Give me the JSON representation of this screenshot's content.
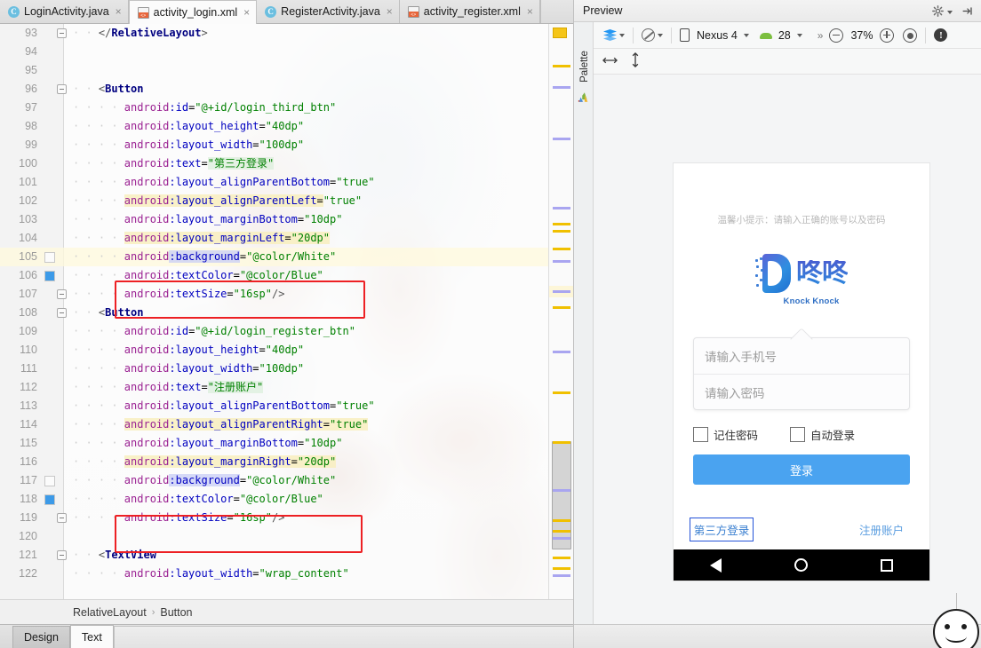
{
  "tabs": [
    {
      "label": "LoginActivity.java",
      "icon": "java-class-icon",
      "active": false
    },
    {
      "label": "activity_login.xml",
      "icon": "xml-layout-icon",
      "active": true
    },
    {
      "label": "RegisterActivity.java",
      "icon": "java-class-icon",
      "active": false
    },
    {
      "label": "activity_register.xml",
      "icon": "xml-layout-icon",
      "active": false
    }
  ],
  "tab_icon_letter": "C",
  "tab_close_glyph": "×",
  "editor": {
    "lines": [
      {
        "n": "93",
        "indent": 4,
        "tokens": [
          {
            "t": "punct",
            "v": "</"
          },
          {
            "t": "tagname",
            "v": "RelativeLayout"
          },
          {
            "t": "punct",
            "v": ">"
          }
        ],
        "fold": true
      },
      {
        "n": "94",
        "indent": 0,
        "tokens": []
      },
      {
        "n": "95",
        "indent": 0,
        "tokens": []
      },
      {
        "n": "96",
        "indent": 4,
        "tokens": [
          {
            "t": "punct",
            "v": "<"
          },
          {
            "t": "tagname",
            "v": "Button"
          }
        ],
        "fold": true
      },
      {
        "n": "97",
        "indent": 8,
        "tokens": [
          {
            "t": "ns",
            "v": "android"
          },
          {
            "t": "attr",
            "v": ":id"
          },
          {
            "t": "eq",
            "v": "="
          },
          {
            "t": "str",
            "v": "\"@+id/login_third_btn\""
          }
        ]
      },
      {
        "n": "98",
        "indent": 8,
        "tokens": [
          {
            "t": "ns",
            "v": "android"
          },
          {
            "t": "attr",
            "v": ":layout_height"
          },
          {
            "t": "eq",
            "v": "="
          },
          {
            "t": "str",
            "v": "\"40dp\""
          }
        ]
      },
      {
        "n": "99",
        "indent": 8,
        "tokens": [
          {
            "t": "ns",
            "v": "android"
          },
          {
            "t": "attr",
            "v": ":layout_width"
          },
          {
            "t": "eq",
            "v": "="
          },
          {
            "t": "str",
            "v": "\"100dp\""
          }
        ]
      },
      {
        "n": "100",
        "indent": 8,
        "tokens": [
          {
            "t": "ns",
            "v": "android"
          },
          {
            "t": "attr",
            "v": ":text"
          },
          {
            "t": "eq",
            "v": "="
          },
          {
            "t": "str hl-green",
            "v": "\"第三方登录\""
          }
        ]
      },
      {
        "n": "101",
        "indent": 8,
        "tokens": [
          {
            "t": "ns",
            "v": "android"
          },
          {
            "t": "attr",
            "v": ":layout_alignParentBottom"
          },
          {
            "t": "eq",
            "v": "="
          },
          {
            "t": "str",
            "v": "\"true\""
          }
        ]
      },
      {
        "n": "102",
        "indent": 8,
        "tokens": [
          {
            "t": "ns hl-yellow",
            "v": "android"
          },
          {
            "t": "attr hl-yellow",
            "v": ":layout_alignParentLeft"
          },
          {
            "t": "eq hl-yellow",
            "v": "="
          },
          {
            "t": "str",
            "v": "\"true\""
          }
        ]
      },
      {
        "n": "103",
        "indent": 8,
        "tokens": [
          {
            "t": "ns",
            "v": "android"
          },
          {
            "t": "attr",
            "v": ":layout_marginBottom"
          },
          {
            "t": "eq",
            "v": "="
          },
          {
            "t": "str",
            "v": "\"10dp\""
          }
        ]
      },
      {
        "n": "104",
        "indent": 8,
        "tokens": [
          {
            "t": "ns hl-yellow",
            "v": "android"
          },
          {
            "t": "attr hl-yellow",
            "v": ":layout_marginLeft"
          },
          {
            "t": "eq hl-yellow",
            "v": "="
          },
          {
            "t": "str hl-yellow",
            "v": "\"20dp\""
          }
        ]
      },
      {
        "n": "105",
        "indent": 8,
        "tokens": [
          {
            "t": "ns",
            "v": "android"
          },
          {
            "t": "attr hl-blue",
            "v": ":background"
          },
          {
            "t": "eq",
            "v": "="
          },
          {
            "t": "str",
            "v": "\"@color/White\""
          }
        ],
        "caret": true,
        "swatch": "#fbfbfb"
      },
      {
        "n": "106",
        "indent": 8,
        "tokens": [
          {
            "t": "ns",
            "v": "android"
          },
          {
            "t": "attr",
            "v": ":textColor"
          },
          {
            "t": "eq",
            "v": "="
          },
          {
            "t": "str",
            "v": "\"@color/Blue\""
          }
        ],
        "swatch": "#3c9ae8"
      },
      {
        "n": "107",
        "indent": 8,
        "tokens": [
          {
            "t": "ns",
            "v": "android"
          },
          {
            "t": "attr",
            "v": ":textSize"
          },
          {
            "t": "eq",
            "v": "="
          },
          {
            "t": "str",
            "v": "\"16sp\""
          },
          {
            "t": "punct",
            "v": "/>"
          }
        ],
        "fold": true
      },
      {
        "n": "108",
        "indent": 4,
        "tokens": [
          {
            "t": "punct",
            "v": "<"
          },
          {
            "t": "tagname",
            "v": "Button"
          }
        ],
        "fold": true
      },
      {
        "n": "109",
        "indent": 8,
        "tokens": [
          {
            "t": "ns",
            "v": "android"
          },
          {
            "t": "attr",
            "v": ":id"
          },
          {
            "t": "eq",
            "v": "="
          },
          {
            "t": "str",
            "v": "\"@+id/login_register_btn\""
          }
        ]
      },
      {
        "n": "110",
        "indent": 8,
        "tokens": [
          {
            "t": "ns",
            "v": "android"
          },
          {
            "t": "attr",
            "v": ":layout_height"
          },
          {
            "t": "eq",
            "v": "="
          },
          {
            "t": "str",
            "v": "\"40dp\""
          }
        ]
      },
      {
        "n": "111",
        "indent": 8,
        "tokens": [
          {
            "t": "ns",
            "v": "android"
          },
          {
            "t": "attr",
            "v": ":layout_width"
          },
          {
            "t": "eq",
            "v": "="
          },
          {
            "t": "str",
            "v": "\"100dp\""
          }
        ]
      },
      {
        "n": "112",
        "indent": 8,
        "tokens": [
          {
            "t": "ns",
            "v": "android"
          },
          {
            "t": "attr",
            "v": ":text"
          },
          {
            "t": "eq",
            "v": "="
          },
          {
            "t": "str hl-green",
            "v": "\"注册账户\""
          }
        ]
      },
      {
        "n": "113",
        "indent": 8,
        "tokens": [
          {
            "t": "ns",
            "v": "android"
          },
          {
            "t": "attr",
            "v": ":layout_alignParentBottom"
          },
          {
            "t": "eq",
            "v": "="
          },
          {
            "t": "str",
            "v": "\"true\""
          }
        ]
      },
      {
        "n": "114",
        "indent": 8,
        "tokens": [
          {
            "t": "ns hl-yellow",
            "v": "android"
          },
          {
            "t": "attr hl-yellow",
            "v": ":layout_alignParentRight"
          },
          {
            "t": "eq hl-yellow",
            "v": "="
          },
          {
            "t": "str hl-yellow",
            "v": "\"true\""
          }
        ]
      },
      {
        "n": "115",
        "indent": 8,
        "tokens": [
          {
            "t": "ns",
            "v": "android"
          },
          {
            "t": "attr",
            "v": ":layout_marginBottom"
          },
          {
            "t": "eq",
            "v": "="
          },
          {
            "t": "str",
            "v": "\"10dp\""
          }
        ]
      },
      {
        "n": "116",
        "indent": 8,
        "tokens": [
          {
            "t": "ns hl-yellow",
            "v": "android"
          },
          {
            "t": "attr hl-yellow",
            "v": ":layout_marginRight"
          },
          {
            "t": "eq hl-yellow",
            "v": "="
          },
          {
            "t": "str hl-yellow",
            "v": "\"20dp\""
          }
        ]
      },
      {
        "n": "117",
        "indent": 8,
        "tokens": [
          {
            "t": "ns",
            "v": "android"
          },
          {
            "t": "attr hl-blue",
            "v": ":background"
          },
          {
            "t": "eq",
            "v": "="
          },
          {
            "t": "str",
            "v": "\"@color/White\""
          }
        ],
        "swatch": "#fbfbfb"
      },
      {
        "n": "118",
        "indent": 8,
        "tokens": [
          {
            "t": "ns",
            "v": "android"
          },
          {
            "t": "attr",
            "v": ":textColor"
          },
          {
            "t": "eq",
            "v": "="
          },
          {
            "t": "str",
            "v": "\"@color/Blue\""
          }
        ],
        "swatch": "#3c9ae8"
      },
      {
        "n": "119",
        "indent": 8,
        "tokens": [
          {
            "t": "ns",
            "v": "android"
          },
          {
            "t": "attr",
            "v": ":textSize"
          },
          {
            "t": "eq",
            "v": "="
          },
          {
            "t": "str",
            "v": "\"16sp\""
          },
          {
            "t": "punct",
            "v": "/>"
          }
        ],
        "fold": true
      },
      {
        "n": "120",
        "indent": 0,
        "tokens": []
      },
      {
        "n": "121",
        "indent": 4,
        "tokens": [
          {
            "t": "punct",
            "v": "<"
          },
          {
            "t": "tagname",
            "v": "TextView"
          }
        ],
        "fold": true
      },
      {
        "n": "122",
        "indent": 8,
        "tokens": [
          {
            "t": "ns",
            "v": "android"
          },
          {
            "t": "attr",
            "v": ":layout_width"
          },
          {
            "t": "eq",
            "v": "="
          },
          {
            "t": "str",
            "v": "\"wrap_content\""
          }
        ]
      }
    ],
    "highlight_color": "#ed2024"
  },
  "breadcrumb": {
    "parent": "RelativeLayout",
    "separator": "›",
    "child": "Button"
  },
  "bottom_tabs": [
    {
      "label": "Design",
      "active": false
    },
    {
      "label": "Text",
      "active": true
    }
  ],
  "preview": {
    "title": "Preview",
    "settings_icon": "gear-icon",
    "collapse_icon": "collapse-panel-icon",
    "palette_label": "Palette",
    "toolbar": {
      "layers_icon": "layers-icon",
      "theme_icon": "theme-icon",
      "device_icon": "phone-icon",
      "device_name": "Nexus 4",
      "api_icon": "android-icon",
      "api_level": "28",
      "overflow": "»",
      "zoom_out_icon": "zoom-out-icon",
      "zoom_level": "37%",
      "zoom_in_icon": "zoom-in-icon",
      "zoom_fit_icon": "zoom-fit-icon",
      "warning_icon": "warning-icon",
      "warning_glyph": "!",
      "width_icon": "resize-horizontal-icon",
      "height_icon": "resize-vertical-icon"
    }
  },
  "device_preview": {
    "hint_text": "温馨小提示：请输入正确的账号以及密码",
    "logo_cn": "咚咚",
    "logo_en": "Knock Knock",
    "phone_placeholder": "请输入手机号",
    "password_placeholder": "请输入密码",
    "remember_label": "记住密码",
    "autologin_label": "自动登录",
    "login_button": "登录",
    "third_party_button": "第三方登录",
    "register_button": "注册账户",
    "nav": {
      "back_icon": "nav-back-icon",
      "home_icon": "nav-home-icon",
      "recents_icon": "nav-recents-icon"
    },
    "colors": {
      "login_button_bg": "#4aa3f0",
      "third_party_border": "#2453d8",
      "link_blue": "#5b9ee0"
    }
  },
  "ime_indicator": {
    "icon": "smiley-face-icon"
  }
}
